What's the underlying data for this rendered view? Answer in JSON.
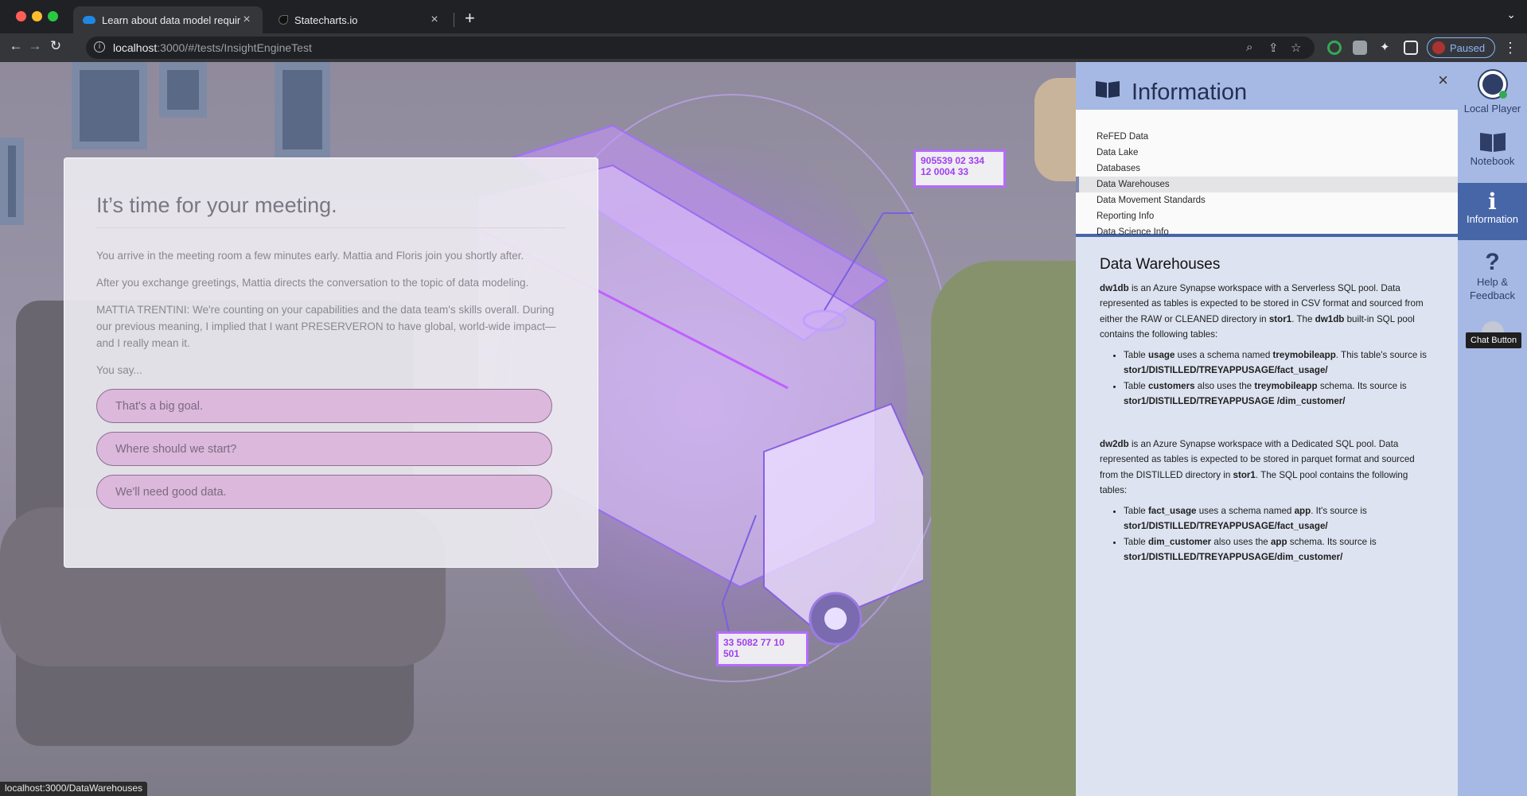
{
  "browser": {
    "tabs": [
      {
        "label": "Learn about data model require",
        "favicon": "onedrive-cloud-icon",
        "active": true
      },
      {
        "label": "Statecharts.io",
        "favicon": "statecharts-icon",
        "active": false
      }
    ],
    "url_host": "localhost",
    "url_rest": ":3000/#/tests/InsightEngineTest",
    "profile_label": "Paused"
  },
  "dialog": {
    "title": "It’s time for your meeting.",
    "paragraphs": [
      "You arrive in the meeting room a few minutes early. Mattia and Floris join you shortly after.",
      "After you exchange greetings, Mattia directs the conversation to the topic of data modeling.",
      "MATTIA TRENTINI: We're counting on your capabilities and the data team's skills overall. During our previous meaning, I implied that I want PRESERVERON to have global, world-wide impact—and I really mean it.",
      "You say..."
    ],
    "choices": [
      "That's a big goal.",
      "Where should we start?",
      "We'll need good data."
    ]
  },
  "scene": {
    "callout_top": [
      "905539 02 334",
      "12 0004 33"
    ],
    "callout_bottom": [
      "33 5082 77 10",
      "501"
    ]
  },
  "info_panel": {
    "title": "Information",
    "nav": [
      "ReFED Data",
      "Data Lake",
      "Databases",
      "Data Warehouses",
      "Data Movement Standards",
      "Reporting Info",
      "Data Science Info"
    ],
    "active_nav": "Data Warehouses",
    "content": {
      "heading": "Data Warehouses",
      "dw1": {
        "name": "dw1db",
        "text1": " is an Azure Synapse workspace with a Serverless SQL pool. Data represented as tables is expected to be stored in CSV format and sourced from either the RAW or CLEANED directory in ",
        "stor": "stor1",
        "text2": ". The ",
        "name2": "dw1db",
        "text3": " built-in SQL pool contains the following tables:",
        "items": [
          {
            "pre": "Table ",
            "table": "usage",
            "mid": " uses a schema named ",
            "schema": "treymobileapp",
            "post": ". This table's source is ",
            "path": "stor1/DISTILLED/TREYAPPUSAGE/fact_usage/"
          },
          {
            "pre": "Table ",
            "table": "customers",
            "mid": " also uses the ",
            "schema": "treymobileapp",
            "post": " schema. Its source is ",
            "path": "stor1/DISTILLED/TREYAPPUSAGE /dim_customer/"
          }
        ]
      },
      "dw2": {
        "name": "dw2db",
        "text1": " is an Azure Synapse workspace with a Dedicated SQL pool. Data represented as tables is expected to be stored in parquet format and sourced from the DISTILLED directory in ",
        "stor": "stor1",
        "text2": ". The SQL pool contains the following tables:",
        "items": [
          {
            "pre": "Table ",
            "table": "fact_usage",
            "mid": " uses a schema named ",
            "schema": "app",
            "post": ". It's source is ",
            "path": "stor1/DISTILLED/TREYAPPUSAGE/fact_usage/"
          },
          {
            "pre": "Table ",
            "table": "dim_customer",
            "mid": " also uses the ",
            "schema": "app",
            "post": " schema. Its source is ",
            "path": "stor1/DISTILLED/TREYAPPUSAGE/dim_customer/"
          }
        ]
      }
    }
  },
  "rail": {
    "items": [
      {
        "label": "Local Player",
        "icon": "avatar-icon"
      },
      {
        "label": "Notebook",
        "icon": "book-icon"
      },
      {
        "label": "Information",
        "icon": "info-icon"
      },
      {
        "label": "Help & Feedback",
        "icon": "question-icon"
      }
    ],
    "chat_tooltip": "Chat Button"
  },
  "status_url": "localhost:3000/DataWarehouses",
  "colors": {
    "panel_header": "#a6b9e4",
    "rail_active": "#4766a8",
    "choice_bg": "#dbb8dc"
  }
}
